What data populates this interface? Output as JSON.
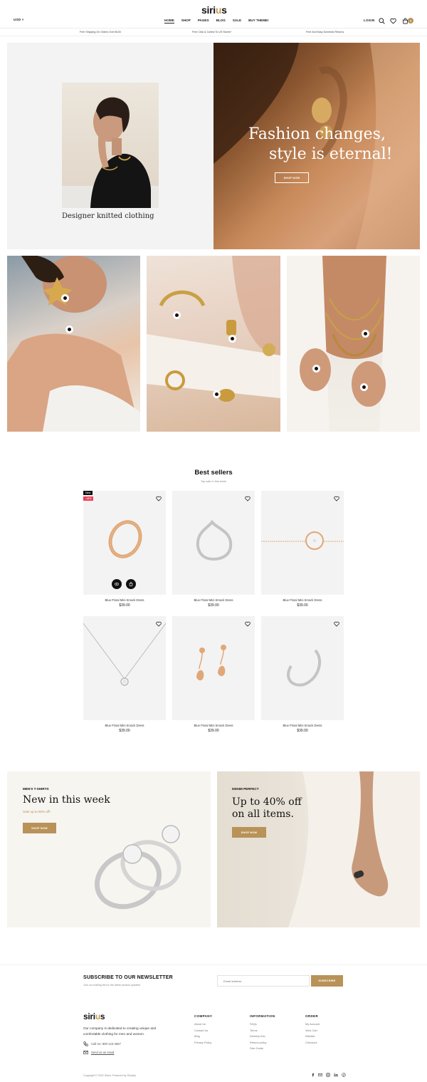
{
  "header": {
    "currency": "USD",
    "logo": {
      "pre": "siri",
      "accent": "u",
      "post": "s"
    },
    "nav": [
      "HOME",
      "SHOP",
      "PAGES",
      "BLOG",
      "SALE",
      "BUY THEME!"
    ],
    "login": "LOGIN",
    "cart_count": "0",
    "notices": [
      "Free Shipping On Orders Over $100",
      "Free Click & Collect To US Stores*",
      "Free And Easy Domestic Returns"
    ]
  },
  "hero": {
    "left_caption": "Designer knitted clothing",
    "title_line1": "Fashion changes,",
    "title_line2": "style is eternal!",
    "button": "SHOP NOW"
  },
  "bestsellers": {
    "title": "Best sellers",
    "subtitle": "Top sale in this week",
    "badge_new": "New",
    "badge_sale": "-18%",
    "products": [
      {
        "name": "Blue Floral Mini Smock Dress",
        "price": "$39.00"
      },
      {
        "name": "Blue Floral Mini Smock Dress",
        "price": "$39.00"
      },
      {
        "name": "Blue Floral Mini Smock Dress",
        "price": "$39.00"
      },
      {
        "name": "Blue Floral Mini Smock Dress",
        "price": "$39.00"
      },
      {
        "name": "Blue Floral Mini Smock Dress",
        "price": "$39.00"
      },
      {
        "name": "Blue Floral Mini Smock Dress",
        "price": "$39.00"
      }
    ]
  },
  "promo": {
    "left": {
      "eyebrow": "MEN'S T-SHIRTS",
      "title": "New in this week",
      "sub": "Sale up to 50% off!",
      "button": "SHOP NOW"
    },
    "right": {
      "eyebrow": "DENIM PERFECT",
      "title_line1": "Up to 40% off",
      "title_line2": "on all items.",
      "button": "SHOP NOW"
    }
  },
  "newsletter": {
    "title": "SUBSCRIBE TO OUR NEWSLETTER",
    "sub": "Join our mailing list for the latest product updates",
    "placeholder": "Email address",
    "button": "SUBSCRIBE"
  },
  "footer": {
    "about": "Our company is dedicated to creating unique and comfortable clothing for men and women.",
    "phone": "Call Us: 800-123-4567",
    "email": "Send us an email",
    "company": {
      "title": "COMPANY",
      "links": [
        "About Us",
        "Contact Us",
        "Blog",
        "Privacy Policy"
      ]
    },
    "information": {
      "title": "INFORMATION",
      "links": [
        "FAQs",
        "Terms",
        "Delivery Info",
        "Refund policy",
        "Size Guide"
      ]
    },
    "order": {
      "title": "ORDER",
      "links": [
        "My Account",
        "View Cart",
        "Wishlist",
        "Checkout"
      ]
    },
    "copyright": "Copyright © 2022 Sirius. Powered by Shopify"
  },
  "colors": {
    "accent": "#b89258",
    "sale_badge": "#e8435a",
    "dark": "#111111"
  }
}
